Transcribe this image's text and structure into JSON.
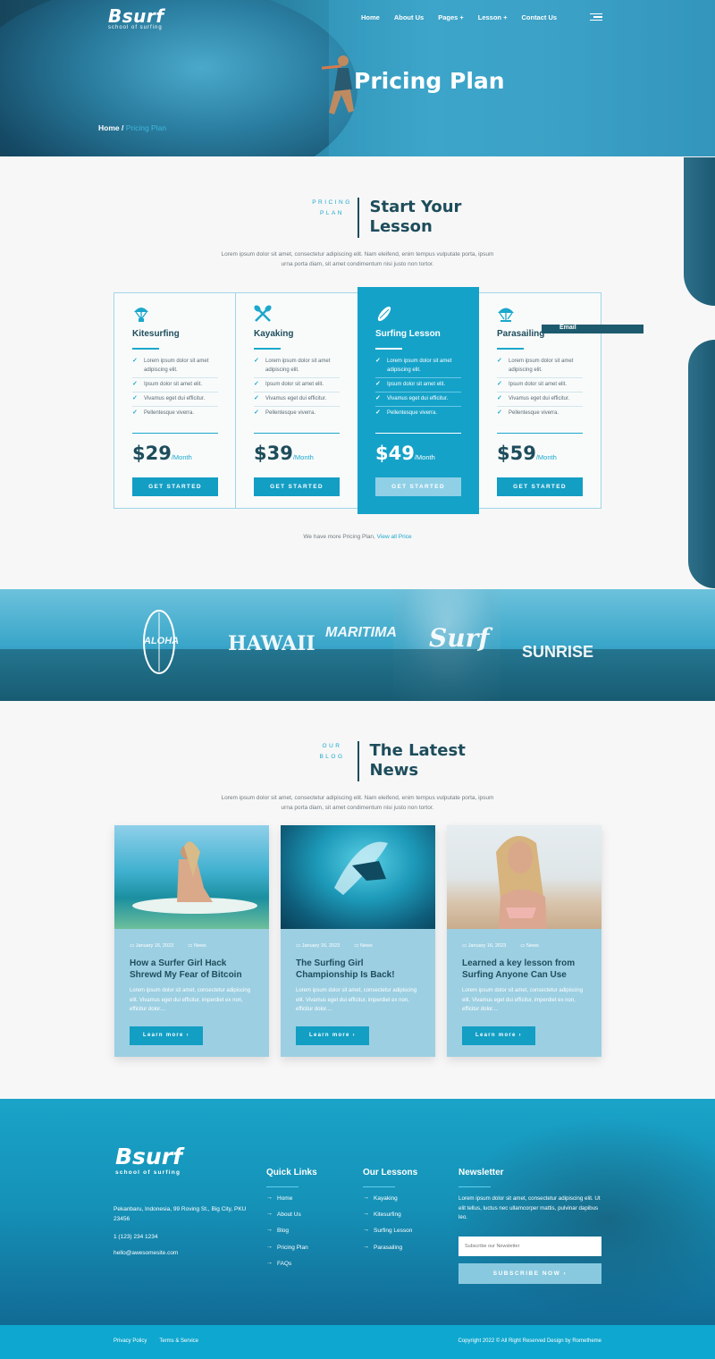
{
  "brand": {
    "name": "Bsurf",
    "tagline": "school of surfing"
  },
  "nav": {
    "items": [
      "Home",
      "About Us",
      "Pages +",
      "Lesson +",
      "Contact Us"
    ]
  },
  "hero": {
    "title": "Pricing Plan",
    "breadcrumb_home": "Home /",
    "breadcrumb_current": "Pricing Plan"
  },
  "pricing": {
    "kicker_1": "PRICING",
    "kicker_2": "PLAN",
    "title_1": "Start Your",
    "title_2": "Lesson",
    "lead_1": "Lorem ipsum dolor sit amet, consectetur adipiscing elit. Nam eleifend, enim tempus vulputate porta, ipsum",
    "lead_2": "urna porta diam, sit amet condimentum nisi justo non tortor.",
    "plans": [
      {
        "name": "Kitesurfing",
        "features": [
          "Lorem ipsum dolor sit amet adipiscing elit.",
          "Ipsum dolor sit amet elit.",
          "Vivamus eget dui efficitur.",
          "Pellentesque viverra."
        ],
        "price": "$29",
        "period": "/Month",
        "button": "GET STARTED"
      },
      {
        "name": "Kayaking",
        "features": [
          "Lorem ipsum dolor sit amet adipiscing elit.",
          "Ipsum dolor sit amet elit.",
          "Vivamus eget dui efficitur.",
          "Pellentesque viverra."
        ],
        "price": "$39",
        "period": "/Month",
        "button": "GET STARTED"
      },
      {
        "name": "Surfing Lesson",
        "features": [
          "Lorem ipsum dolor sit amet adipiscing elit.",
          "Ipsum dolor sit amet elit.",
          "Vivamus eget dui efficitur.",
          "Pellentesque viverra."
        ],
        "price": "$49",
        "period": "/Month",
        "button": "GET STARTED"
      },
      {
        "name": "Parasailing",
        "features": [
          "Lorem ipsum dolor sit amet adipiscing elit.",
          "Ipsum dolor sit amet elit.",
          "Vivamus eget dui efficitur.",
          "Pellentesque viverra."
        ],
        "price": "$59",
        "period": "/Month",
        "button": "GET STARTED"
      }
    ],
    "email_tag": "Email",
    "more_text": "We have more Pricing Plan,",
    "more_link": "View all Price"
  },
  "brands": [
    "ALOHA",
    "HAWAII",
    "MARITIMA",
    "Surf",
    "SUNRISE"
  ],
  "blog": {
    "kicker_1": "OUR",
    "kicker_2": "BLOG",
    "title_1": "The Latest",
    "title_2": "News",
    "lead_1": "Lorem ipsum dolor sit amet, consectetur adipiscing elit. Nam eleifend, enim tempus vulputate porta, ipsum",
    "lead_2": "urna porta diam, sit amet condimentum nisi justo non tortor.",
    "posts": [
      {
        "date": "January 16, 2023",
        "category": "News",
        "title": "How a Surfer Girl Hack Shrewd My Fear of Bitcoin",
        "excerpt": "Lorem ipsum dolor sit amet, consectetur adipiscing elit. Vivamus eget dui efficitur, imperdiet ex non, efficitur dolor....",
        "button": "Learn more ›"
      },
      {
        "date": "January 16, 2023",
        "category": "News",
        "title": "The Surfing Girl Championship Is Back!",
        "excerpt": "Lorem ipsum dolor sit amet, consectetur adipiscing elit. Vivamus eget dui efficitur, imperdiet ex non, efficitur dolor....",
        "button": "Learn more ›"
      },
      {
        "date": "January 16, 2023",
        "category": "News",
        "title": "Learned a key lesson from Surfing Anyone Can Use",
        "excerpt": "Lorem ipsum dolor sit amet, consectetur adipiscing elit. Vivamus eget dui efficitur, imperdiet ex non, efficitur dolor....",
        "button": "Learn more ›"
      }
    ]
  },
  "footer": {
    "address": "Pekanbaru, Indonesia, 99 Roving St., Big City, PKU 23456",
    "phone": "1 (123) 234 1234",
    "email": "hello@awesomesite.com",
    "quick_links_title": "Quick Links",
    "quick_links": [
      "Home",
      "About Us",
      "Blog",
      "Pricing Plan",
      "FAQs"
    ],
    "lessons_title": "Our Lessons",
    "lessons": [
      "Kayaking",
      "Kitesurfing",
      "Surfing Lesson",
      "Parasailing"
    ],
    "newsletter_title": "Newsletter",
    "newsletter_text": "Lorem ipsum dolor sit amet, consectetur adipiscing elit. Ut elit tellus, luctus nec ullamcorper mattis, pulvinar dapibus leo.",
    "newsletter_placeholder": "Subscribe our Newsletter",
    "subscribe_button": "SUBSCRIBE NOW ›",
    "privacy": "Privacy Policy",
    "terms": "Terms & Service",
    "copyright": "Copyright 2022 © All Right Reserved Design by Rometheme"
  },
  "colors": {
    "accent": "#139ec4",
    "dark": "#1e4d5c",
    "featured": "#15a2c9",
    "card": "#9ccfe2"
  }
}
